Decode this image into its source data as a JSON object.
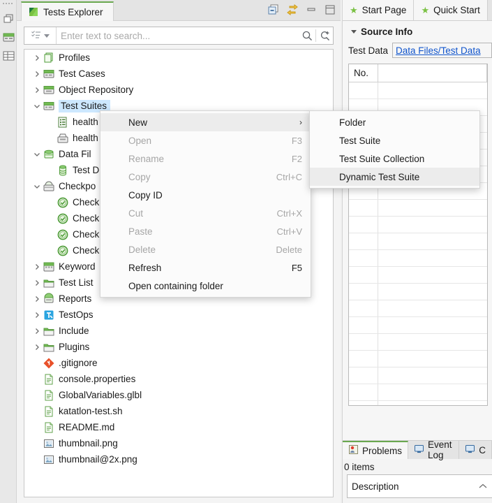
{
  "colors": {
    "accent_green": "#7ac143",
    "selection_blue": "#cde8ff",
    "link_blue": "#1155cc",
    "menu_bg": "#fbfbfb",
    "highlight_gray": "#ececec",
    "panel_bg": "#f4f4f4"
  },
  "explorer": {
    "tab_label": "Tests Explorer",
    "tab_icon": "katalon-logo-icon",
    "view_tools": [
      {
        "name": "collapse-all-icon",
        "tooltip": "Collapse All"
      },
      {
        "name": "link-with-editor-icon",
        "tooltip": "Link with Editor"
      },
      {
        "name": "minimize-icon",
        "tooltip": "Minimize"
      },
      {
        "name": "maximize-icon",
        "tooltip": "Maximize"
      }
    ],
    "search": {
      "placeholder": "Enter text to search...",
      "value": "",
      "filter_icon": "filter-list-icon",
      "search_icon": "magnifier-icon",
      "advanced_search_icon": "magnifier-plus-icon"
    },
    "tree": [
      {
        "label": "Profiles",
        "icon": "profiles-icon",
        "indent": 0,
        "expander": "collapsed",
        "selected": false
      },
      {
        "label": "Test Cases",
        "icon": "test-cases-icon",
        "indent": 0,
        "expander": "collapsed",
        "selected": false
      },
      {
        "label": "Object Repository",
        "icon": "object-repo-icon",
        "indent": 0,
        "expander": "collapsed",
        "selected": false
      },
      {
        "label": "Test Suites",
        "icon": "test-suites-icon",
        "indent": 0,
        "expander": "expanded",
        "selected": true
      },
      {
        "label": "health",
        "icon": "test-suite-icon",
        "indent": 1,
        "expander": "none",
        "selected": false
      },
      {
        "label": "health",
        "icon": "test-suite-coll-icon",
        "indent": 1,
        "expander": "none",
        "selected": false
      },
      {
        "label": "Data Fil",
        "icon": "data-files-icon",
        "indent": 0,
        "expander": "expanded",
        "selected": false
      },
      {
        "label": "Test D",
        "icon": "data-file-icon",
        "indent": 1,
        "expander": "none",
        "selected": false
      },
      {
        "label": "Checkpo",
        "icon": "checkpoints-icon",
        "indent": 0,
        "expander": "expanded",
        "selected": false
      },
      {
        "label": "Check",
        "icon": "checkpoint-icon",
        "indent": 1,
        "expander": "none",
        "selected": false
      },
      {
        "label": "Check",
        "icon": "checkpoint-icon",
        "indent": 1,
        "expander": "none",
        "selected": false
      },
      {
        "label": "Check",
        "icon": "checkpoint-icon",
        "indent": 1,
        "expander": "none",
        "selected": false
      },
      {
        "label": "Check",
        "icon": "checkpoint-icon",
        "indent": 1,
        "expander": "none",
        "selected": false
      },
      {
        "label": "Keyword",
        "icon": "keywords-icon",
        "indent": 0,
        "expander": "collapsed",
        "selected": false
      },
      {
        "label": "Test List",
        "icon": "folder-icon",
        "indent": 0,
        "expander": "collapsed",
        "selected": false
      },
      {
        "label": "Reports",
        "icon": "reports-icon",
        "indent": 0,
        "expander": "collapsed",
        "selected": false
      },
      {
        "label": "TestOps",
        "icon": "testops-icon",
        "indent": 0,
        "expander": "collapsed",
        "selected": false
      },
      {
        "label": "Include",
        "icon": "folder-icon",
        "indent": 0,
        "expander": "collapsed",
        "selected": false
      },
      {
        "label": "Plugins",
        "icon": "folder-icon",
        "indent": 0,
        "expander": "collapsed",
        "selected": false
      },
      {
        "label": ".gitignore",
        "icon": "git-icon",
        "indent": 0,
        "expander": "none",
        "selected": false
      },
      {
        "label": "console.properties",
        "icon": "text-file-icon",
        "indent": 0,
        "expander": "none",
        "selected": false
      },
      {
        "label": "GlobalVariables.glbl",
        "icon": "text-file-icon",
        "indent": 0,
        "expander": "none",
        "selected": false
      },
      {
        "label": "katatlon-test.sh",
        "icon": "text-file-icon",
        "indent": 0,
        "expander": "none",
        "selected": false
      },
      {
        "label": "README.md",
        "icon": "text-file-icon",
        "indent": 0,
        "expander": "none",
        "selected": false
      },
      {
        "label": "thumbnail.png",
        "icon": "image-file-icon",
        "indent": 0,
        "expander": "none",
        "selected": false
      },
      {
        "label": "thumbnail@2x.png",
        "icon": "image-file-icon",
        "indent": 0,
        "expander": "none",
        "selected": false
      }
    ]
  },
  "context_menu": {
    "items": [
      {
        "label": "New",
        "accel": "",
        "disabled": false,
        "highlighted": true,
        "submenu": true
      },
      {
        "label": "Open",
        "accel": "F3",
        "disabled": true,
        "highlighted": false,
        "submenu": false
      },
      {
        "label": "Rename",
        "accel": "F2",
        "disabled": true,
        "highlighted": false,
        "submenu": false
      },
      {
        "label": "Copy",
        "accel": "Ctrl+C",
        "disabled": true,
        "highlighted": false,
        "submenu": false
      },
      {
        "label": "Copy ID",
        "accel": "",
        "disabled": false,
        "highlighted": false,
        "submenu": false
      },
      {
        "label": "Cut",
        "accel": "Ctrl+X",
        "disabled": true,
        "highlighted": false,
        "submenu": false
      },
      {
        "label": "Paste",
        "accel": "Ctrl+V",
        "disabled": true,
        "highlighted": false,
        "submenu": false
      },
      {
        "label": "Delete",
        "accel": "Delete",
        "disabled": true,
        "highlighted": false,
        "submenu": false
      },
      {
        "label": "Refresh",
        "accel": "F5",
        "disabled": false,
        "highlighted": false,
        "submenu": false
      },
      {
        "label": "Open containing folder",
        "accel": "",
        "disabled": false,
        "highlighted": false,
        "submenu": false
      }
    ],
    "submenu_arrow": "chevron-right-icon"
  },
  "new_submenu": {
    "items": [
      {
        "label": "Folder",
        "highlighted": false
      },
      {
        "label": "Test Suite",
        "highlighted": false
      },
      {
        "label": "Test Suite Collection",
        "highlighted": false
      },
      {
        "label": "Dynamic Test Suite",
        "highlighted": true
      }
    ]
  },
  "right_pane": {
    "tabs": [
      {
        "label": "Start Page",
        "icon": "star-icon",
        "active": false
      },
      {
        "label": "Quick Start",
        "icon": "star-icon",
        "active": false
      }
    ],
    "section_title": "Source Info",
    "section_twisty": "triangle-down-icon",
    "test_data_label": "Test Data",
    "test_data_link": "Data Files/Test Data",
    "grid": {
      "columns": [
        "No.",
        ""
      ],
      "rows": []
    },
    "bottom_tabs": [
      {
        "label": "Problems",
        "icon": "problems-icon",
        "active": true
      },
      {
        "label": "Event Log",
        "icon": "console-icon",
        "active": false
      },
      {
        "label": "C",
        "icon": "console-icon",
        "active": false
      }
    ],
    "items_count": "0 items",
    "description_header": "Description",
    "sort_indicator": "caret-up-icon"
  }
}
